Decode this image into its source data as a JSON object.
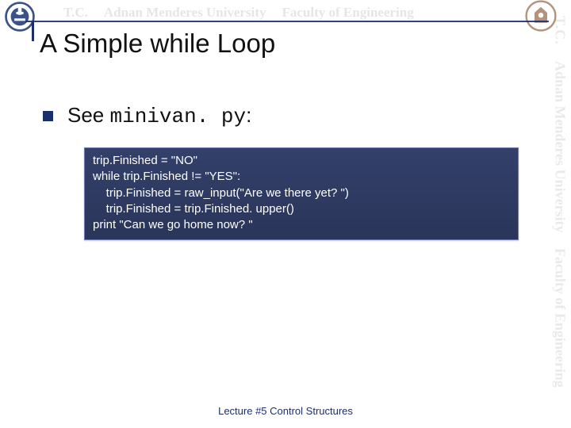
{
  "watermark": {
    "top_tc": "T.C.",
    "top_univ": "Adnan Menderes University",
    "top_fac": "Faculty of Engineering",
    "side_tc": "T.C.",
    "side_univ": "Adnan Menderes University",
    "side_fac": "Faculty of Engineering"
  },
  "title": "A Simple while Loop",
  "bullet": {
    "see": "See ",
    "filename": "minivan. py",
    "colon": ":"
  },
  "code": {
    "l1": "trip.Finished = \"NO\"",
    "l2": "while trip.Finished != \"YES\":",
    "l3": "    trip.Finished = raw_input(\"Are we there yet? \")",
    "l4": "    trip.Finished = trip.Finished. upper()",
    "l5": "",
    "l6": "print \"Can we go home now? \""
  },
  "footer": "Lecture #5 Control Structures"
}
